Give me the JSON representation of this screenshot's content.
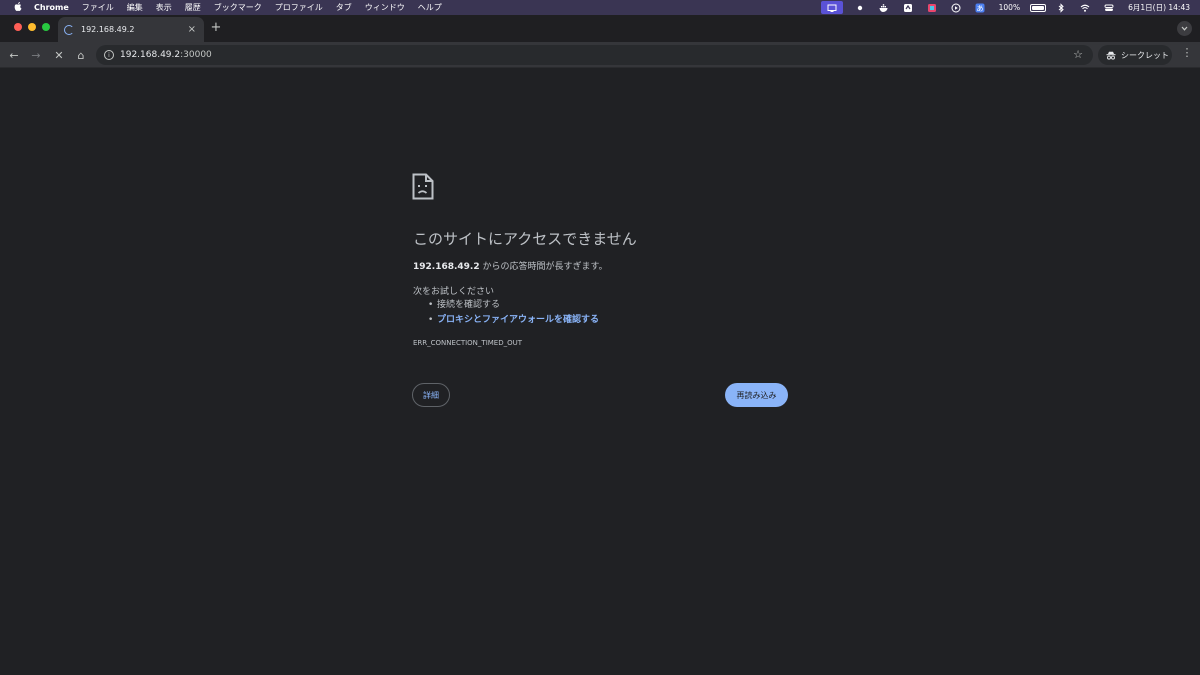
{
  "menubar": {
    "apple": "",
    "items": [
      "Chrome",
      "ファイル",
      "編集",
      "表示",
      "履歴",
      "ブックマーク",
      "プロファイル",
      "タブ",
      "ウィンドウ",
      "ヘルプ"
    ],
    "battery_text": "100%",
    "datetime": "6月1日(日)  14:43"
  },
  "tab": {
    "title": "192.168.49.2",
    "close": "×",
    "new_tab": "+"
  },
  "toolbar": {
    "back": "←",
    "forward": "→",
    "stop": "✕",
    "home": "⌂",
    "url_host": "192.168.49.2",
    "url_port": ":30000",
    "bookmark": "☆",
    "incognito_label": "シークレット",
    "menu": "⋮"
  },
  "error": {
    "title": "このサイトにアクセスできません",
    "host": "192.168.49.2",
    "desc_suffix": " からの応答時間が長すぎます。",
    "suggest_heading": "次をお試しください",
    "suggestions": [
      "接続を確認する",
      "プロキシとファイアウォールを確認する"
    ],
    "code": "ERR_CONNECTION_TIMED_OUT",
    "details_label": "詳細",
    "reload_label": "再読み込み"
  },
  "colors": {
    "page_bg": "#202124",
    "link": "#8ab4f8",
    "menubar_bg": "#3a3553"
  }
}
